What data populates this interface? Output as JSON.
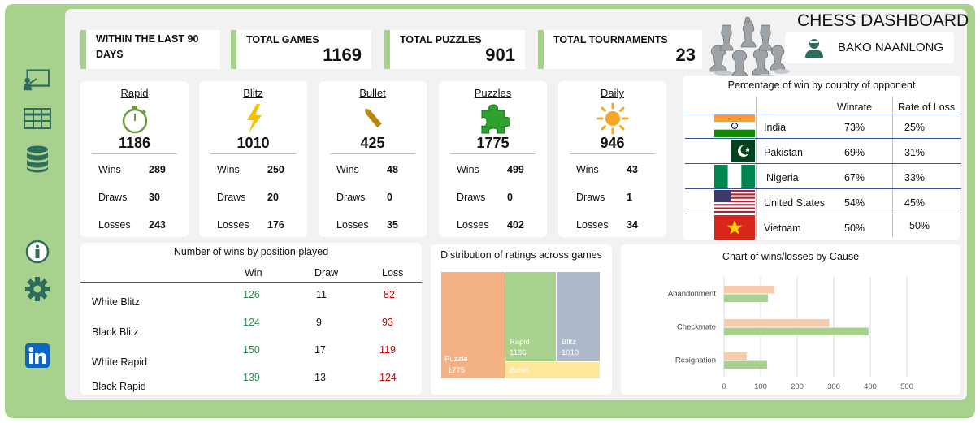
{
  "dashboard": {
    "title": "CHESS DASHBOARD",
    "user_name": "BAKO NAANLONG",
    "colors": {
      "frame": "#a9d18e",
      "panel": "#f2f2f2",
      "win": "#2e8b57",
      "loss": "#d00000"
    }
  },
  "sidebar": {
    "icons": [
      "presentation-icon",
      "table-icon",
      "database-icon",
      "info-icon",
      "gear-icon",
      "linkedin-icon"
    ]
  },
  "kpis": [
    {
      "label": "WITHIN THE LAST 90 DAYS",
      "value": ""
    },
    {
      "label": "TOTAL GAMES",
      "value": "1169"
    },
    {
      "label": "TOTAL PUZZLES",
      "value": "901"
    },
    {
      "label": "TOTAL TOURNAMENTS",
      "value": "23"
    }
  ],
  "modes": [
    {
      "name": "Rapid",
      "icon": "stopwatch-icon",
      "total": "1186",
      "wins": "289",
      "draws": "30",
      "losses": "243"
    },
    {
      "name": "Blitz",
      "icon": "lightning-icon",
      "total": "1010",
      "wins": "250",
      "draws": "20",
      "losses": "176"
    },
    {
      "name": "Bullet",
      "icon": "bullet-icon",
      "total": "425",
      "wins": "48",
      "draws": "0",
      "losses": "35"
    },
    {
      "name": "Puzzles",
      "icon": "puzzle-icon",
      "total": "1775",
      "wins": "499",
      "draws": "0",
      "losses": "402"
    },
    {
      "name": "Daily",
      "icon": "sun-icon",
      "total": "946",
      "wins": "43",
      "draws": "1",
      "losses": "34"
    }
  ],
  "row_labels": {
    "wins": "Wins",
    "draws": "Draws",
    "losses": "Losses"
  },
  "country": {
    "title": "Percentage of win by country of opponent",
    "col_winrate": "Winrate",
    "col_loss": "Rate of Loss",
    "rows": [
      {
        "country": "India",
        "flag": "india-flag-icon",
        "winrate": "73%",
        "loss": "25%"
      },
      {
        "country": "Pakistan",
        "flag": "pakistan-flag-icon",
        "winrate": "69%",
        "loss": "31%"
      },
      {
        "country": "Nigeria",
        "flag": "nigeria-flag-icon",
        "winrate": "67%",
        "loss": "33%"
      },
      {
        "country": "United States",
        "flag": "usa-flag-icon",
        "winrate": "54%",
        "loss": "45%"
      },
      {
        "country": "Vietnam",
        "flag": "vietnam-flag-icon",
        "winrate": "50%",
        "loss": "50%"
      }
    ]
  },
  "position": {
    "title": "Number of wins by position played",
    "headers": [
      "Win",
      "Draw",
      "Loss"
    ],
    "rows": [
      {
        "label": "White Blitz",
        "win": "126",
        "draw": "11",
        "loss": "82"
      },
      {
        "label": "Black Blitz",
        "win": "124",
        "draw": "9",
        "loss": "93"
      },
      {
        "label": "White Rapid",
        "win": "150",
        "draw": "17",
        "loss": "119"
      },
      {
        "label": "Black Rapid",
        "win": "139",
        "draw": "13",
        "loss": "124"
      }
    ]
  },
  "treemap": {
    "title": "Distribution of ratings across games",
    "tiles": [
      {
        "label": "Puzzle",
        "value": "1775",
        "color": "#f4b183"
      },
      {
        "label": "Rapid",
        "value": "1186",
        "color": "#a9d18e"
      },
      {
        "label": "Blitz",
        "value": "1010",
        "color": "#adb9ca"
      },
      {
        "label": "Bullet",
        "value": "",
        "color": "#ffe699"
      }
    ]
  },
  "chart_data": {
    "type": "bar",
    "orientation": "horizontal",
    "title": "Chart of wins/losses by Cause",
    "categories": [
      "Abandonment",
      "Checkmate",
      "Resignation"
    ],
    "series": [
      {
        "values": [
          138,
          288,
          62
        ],
        "color": "#f8cbad"
      },
      {
        "values": [
          120,
          395,
          118
        ],
        "color": "#a9d18e"
      }
    ],
    "xlim": [
      0,
      500
    ],
    "x_ticks": [
      "0",
      "100",
      "200",
      "300",
      "400",
      "500"
    ],
    "grid": true
  }
}
